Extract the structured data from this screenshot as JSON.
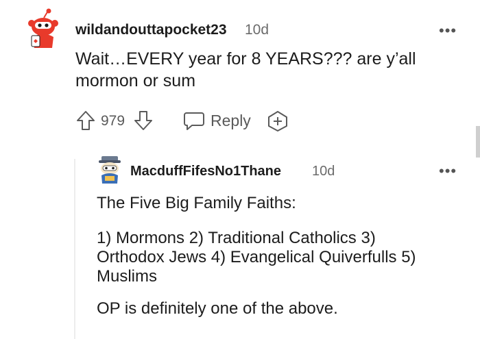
{
  "comment": {
    "username": "wildandouttapocket23",
    "time": "10d",
    "body_line1": "Wait…EVERY year for 8 YEARS??? are y’all",
    "body_line2": "mormon or sum",
    "votes": "979",
    "reply_label": "Reply",
    "avatar_icon": "snoo-avatar-icon",
    "more_icon": "more-options-icon"
  },
  "reply": {
    "username": "MacduffFifesNo1Thane",
    "time": "10d",
    "paragraph1": "The Five Big Family Faiths:",
    "paragraph2_line1": "1) Mormons 2) Traditional Catholics 3)",
    "paragraph2_line2": "Orthodox Jews 4) Evangelical Quiverfulls 5)",
    "paragraph2_line3": "Muslims",
    "paragraph3": "OP is definitely one of the above.",
    "avatar_icon": "snoo-avatar-icon",
    "more_icon": "more-options-icon"
  },
  "colors": {
    "text": "#1c1c1c",
    "meta": "#6b6b6b",
    "avatar_red": "#e83a2b"
  }
}
